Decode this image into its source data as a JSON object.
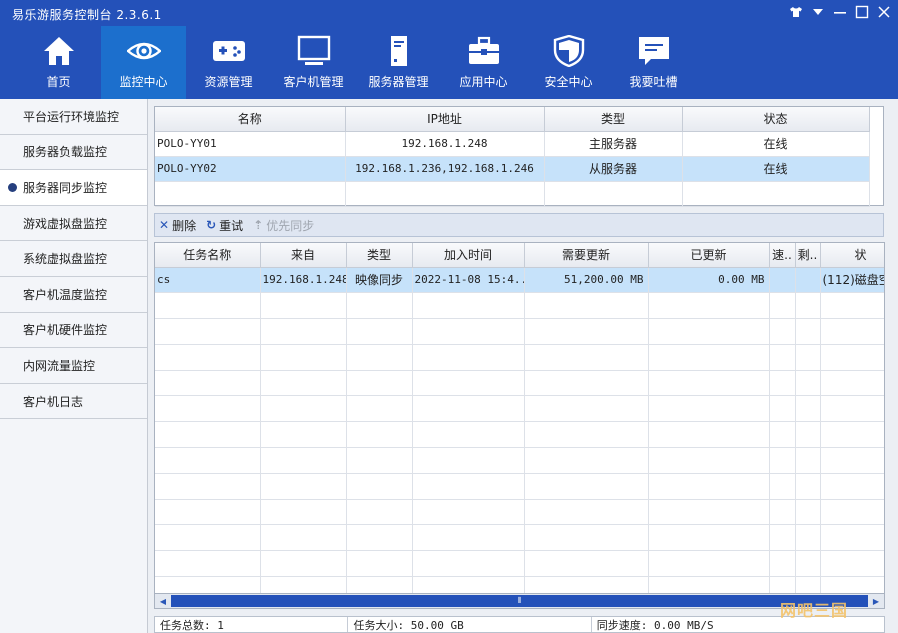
{
  "app": {
    "title": "易乐游服务控制台 2.3.6.1"
  },
  "window_controls": [
    "shirt-icon",
    "dropdown-icon",
    "minimize-icon",
    "maximize-icon",
    "close-icon"
  ],
  "nav": [
    {
      "label": "首页",
      "icon": "home-icon",
      "active": false
    },
    {
      "label": "监控中心",
      "icon": "eye-icon",
      "active": true
    },
    {
      "label": "资源管理",
      "icon": "gamepad-icon",
      "active": false
    },
    {
      "label": "客户机管理",
      "icon": "monitor-icon",
      "active": false
    },
    {
      "label": "服务器管理",
      "icon": "server-icon",
      "active": false
    },
    {
      "label": "应用中心",
      "icon": "toolbox-icon",
      "active": false
    },
    {
      "label": "安全中心",
      "icon": "shield-icon",
      "active": false
    },
    {
      "label": "我要吐槽",
      "icon": "feedback-icon",
      "active": false
    }
  ],
  "sidebar": {
    "items": [
      {
        "label": "平台运行环境监控",
        "active": false
      },
      {
        "label": "服务器负载监控",
        "active": false
      },
      {
        "label": "服务器同步监控",
        "active": true
      },
      {
        "label": "游戏虚拟盘监控",
        "active": false
      },
      {
        "label": "系统虚拟盘监控",
        "active": false
      },
      {
        "label": "客户机温度监控",
        "active": false
      },
      {
        "label": "客户机硬件监控",
        "active": false
      },
      {
        "label": "内网流量监控",
        "active": false
      },
      {
        "label": "客户机日志",
        "active": false
      }
    ]
  },
  "servers": {
    "headers": [
      "名称",
      "IP地址",
      "类型",
      "状态"
    ],
    "rows": [
      {
        "name": "POLO-YY01",
        "ip": "192.168.1.248",
        "type": "主服务器",
        "status": "在线",
        "selected": false
      },
      {
        "name": "POLO-YY02",
        "ip": "192.168.1.236,192.168.1.246",
        "type": "从服务器",
        "status": "在线",
        "selected": true
      }
    ]
  },
  "toolbar": {
    "delete_label": "删除",
    "retry_label": "重试",
    "priority_label": "优先同步"
  },
  "tasks": {
    "headers": [
      "任务名称",
      "来自",
      "类型",
      "加入时间",
      "需要更新",
      "已更新",
      "速..",
      "剩..",
      "状"
    ],
    "rows": [
      {
        "name": "cs",
        "from": "192.168.1.248",
        "type": "映像同步",
        "time": "2022-11-08 15:4...",
        "need": "51,200.00 MB",
        "done": "0.00 MB",
        "speed": "",
        "remain": "",
        "status": "(112)磁盘空"
      }
    ]
  },
  "status": {
    "total": "任务总数: 1",
    "size": "任务大小: 50.00 GB",
    "speed": "同步速度: 0.00 MB/S"
  },
  "watermark": "网吧三国",
  "colors": {
    "header": "#2451b9",
    "nav_active": "#1c6fcd",
    "row_selected": "#c6e2fa",
    "watermark": "#f4c36a"
  }
}
